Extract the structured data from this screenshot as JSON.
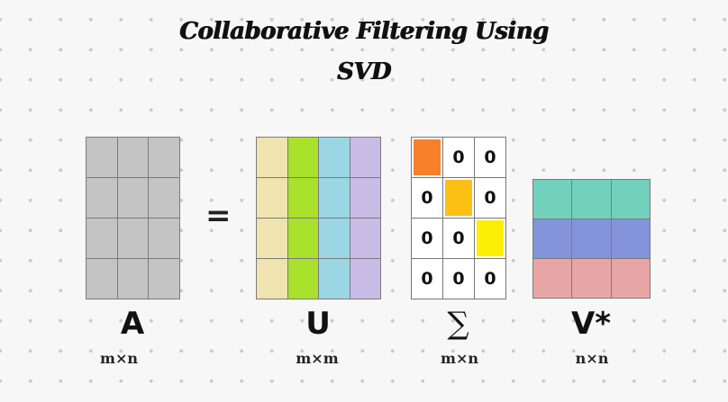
{
  "title_line1": "Collaborative Filtering Using",
  "title_line2": "SVD",
  "equals_sign": "=",
  "matrices": {
    "A": {
      "label": "A",
      "dims": "m×n",
      "color": "#c4c4c4",
      "rows": 4,
      "cols": 3
    },
    "U": {
      "label": "U",
      "dims": "m×m",
      "column_colors": [
        "#efe3b0",
        "#a9e12c",
        "#9ad6e4",
        "#c9bce6"
      ],
      "rows": 4
    },
    "Sigma": {
      "label": "∑",
      "dims": "m×n",
      "cells": [
        [
          "",
          "0",
          "0"
        ],
        [
          "0",
          "",
          "0"
        ],
        [
          "0",
          "0",
          ""
        ],
        [
          "0",
          "0",
          "0"
        ]
      ],
      "diagonal_colors": [
        "#f7802a",
        "#fcc015",
        "#fbee07"
      ]
    },
    "V": {
      "label": "V*",
      "dims": "n×n",
      "row_colors": [
        "#72d1bd",
        "#8494db",
        "#e8a5a5"
      ],
      "cols": 3
    }
  }
}
